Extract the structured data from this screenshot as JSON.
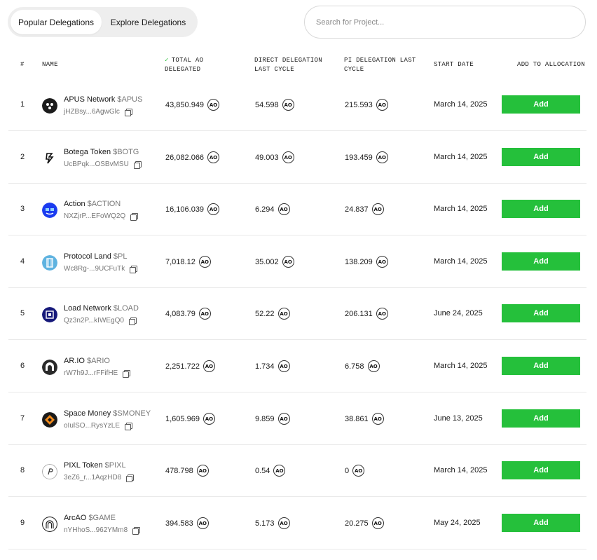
{
  "tabs": [
    {
      "label": "Popular Delegations",
      "active": true
    },
    {
      "label": "Explore Delegations",
      "active": false
    }
  ],
  "search": {
    "placeholder": "Search for Project...",
    "value": ""
  },
  "table": {
    "headers": {
      "index": "#",
      "name": "NAME",
      "total_line1": "TOTAL AO",
      "total_line2": "DELEGATED",
      "direct_line1": "DIRECT DELEGATION",
      "direct_line2": "LAST CYCLE",
      "pi_line1": "PI DELEGATION LAST",
      "pi_line2": "CYCLE",
      "start_date": "START DATE",
      "add": "ADD TO ALLOCATION"
    },
    "sort_icon": "chevron-down-icon",
    "ao_token_label": "AO",
    "add_label": "Add",
    "accent_color": "#25c03b",
    "rows": [
      {
        "index": "1",
        "name": "APUS Network",
        "ticker": "$APUS",
        "address": "jHZBsy...6AgwGlc",
        "total": "43,850.949",
        "direct": "54.598",
        "pi": "215.593",
        "start_date": "March 14, 2025",
        "logo": "apus-logo-icon"
      },
      {
        "index": "2",
        "name": "Botega Token",
        "ticker": "$BOTG",
        "address": "UcBPqk...OSBvMSU",
        "total": "26,082.066",
        "direct": "49.003",
        "pi": "193.459",
        "start_date": "March 14, 2025",
        "logo": "botega-logo-icon"
      },
      {
        "index": "3",
        "name": "Action",
        "ticker": "$ACTION",
        "address": "NXZjrP...EFoWQ2Q",
        "total": "16,106.039",
        "direct": "6.294",
        "pi": "24.837",
        "start_date": "March 14, 2025",
        "logo": "action-logo-icon"
      },
      {
        "index": "4",
        "name": "Protocol Land",
        "ticker": "$PL",
        "address": "Wc8Rg-...9UCFuTk",
        "total": "7,018.12",
        "direct": "35.002",
        "pi": "138.209",
        "start_date": "March 14, 2025",
        "logo": "protocol-land-logo-icon"
      },
      {
        "index": "5",
        "name": "Load Network",
        "ticker": "$LOAD",
        "address": "Qz3n2P...kIWEgQ0",
        "total": "4,083.79",
        "direct": "52.22",
        "pi": "206.131",
        "start_date": "June 24, 2025",
        "logo": "load-network-logo-icon"
      },
      {
        "index": "6",
        "name": "AR.IO",
        "ticker": "$ARIO",
        "address": "rW7h9J...rFFifHE",
        "total": "2,251.722",
        "direct": "1.734",
        "pi": "6.758",
        "start_date": "March 14, 2025",
        "logo": "ario-logo-icon"
      },
      {
        "index": "7",
        "name": "Space Money",
        "ticker": "$SMONEY",
        "address": "oIulSO...RysYzLE",
        "total": "1,605.969",
        "direct": "9.859",
        "pi": "38.861",
        "start_date": "June 13, 2025",
        "logo": "space-money-logo-icon"
      },
      {
        "index": "8",
        "name": "PIXL Token",
        "ticker": "$PIXL",
        "address": "3eZ6_r...1AqzHD8",
        "total": "478.798",
        "direct": "0.54",
        "pi": "0",
        "start_date": "March 14, 2025",
        "logo": "pixl-logo-icon"
      },
      {
        "index": "9",
        "name": "ArcAO",
        "ticker": "$GAME",
        "address": "nYHhoS...962YMm8",
        "total": "394.583",
        "direct": "5.173",
        "pi": "20.275",
        "start_date": "May 24, 2025",
        "logo": "arcao-logo-icon"
      }
    ]
  }
}
